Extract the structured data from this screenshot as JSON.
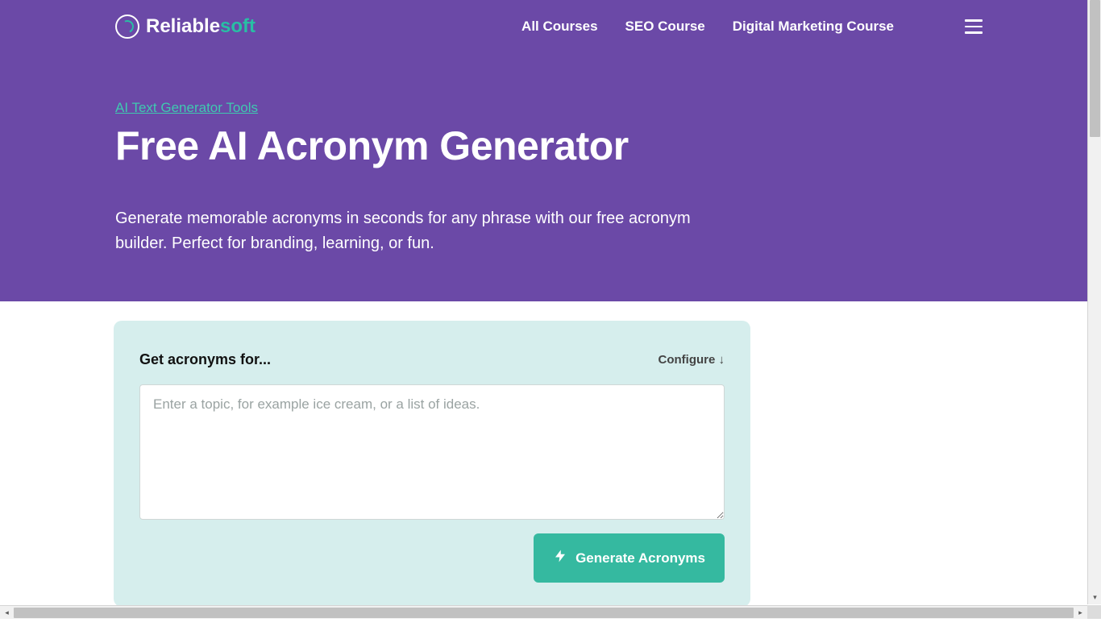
{
  "brand": {
    "name_part1": "Reliable",
    "name_part2": "soft"
  },
  "nav": {
    "items": [
      {
        "label": "All Courses"
      },
      {
        "label": "SEO Course"
      },
      {
        "label": "Digital Marketing Course"
      }
    ]
  },
  "hero": {
    "breadcrumb": "AI Text Generator Tools",
    "title": "Free AI Acronym Generator",
    "description": "Generate memorable acronyms in seconds for any phrase with our free acronym builder. Perfect for branding, learning, or fun."
  },
  "tool": {
    "label": "Get acronyms for...",
    "configure_label": "Configure ↓",
    "placeholder": "Enter a topic, for example ice cream, or a list of ideas.",
    "input_value": "",
    "button_label": "Generate Acronyms"
  },
  "colors": {
    "hero_bg": "#6b49a7",
    "accent": "#35b9a0",
    "card_bg": "#d6eeed"
  }
}
